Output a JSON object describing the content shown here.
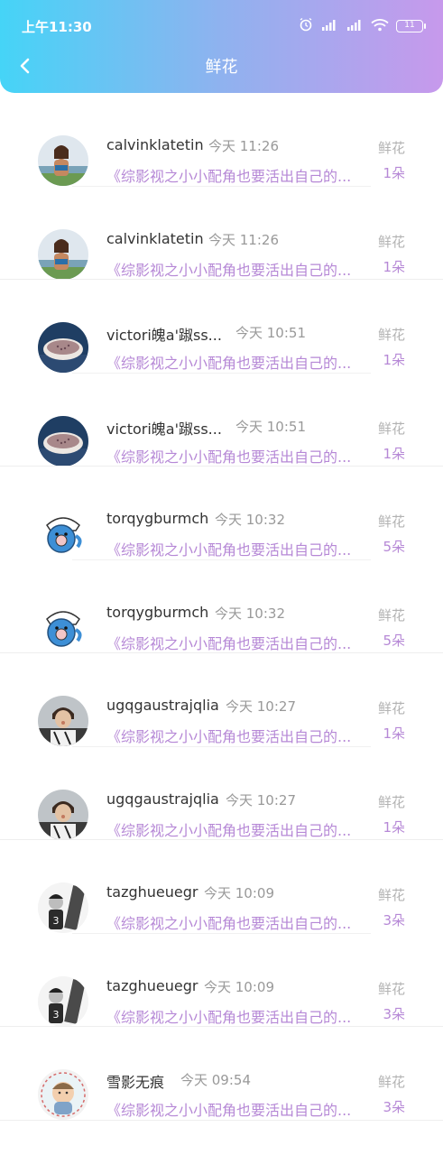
{
  "status": {
    "time": "上午11:30",
    "battery": "11"
  },
  "header": {
    "title": "鲜花"
  },
  "items": [
    {
      "username": "calvinklatetin",
      "time": "今天 11:26",
      "subject": "《综影视之小小配角也要活出自己的...",
      "gift": "鲜花",
      "count": "1朵",
      "avatar": "beach-woman"
    },
    {
      "username": "calvinklatetin",
      "time": "今天 11:26",
      "subject": "《综影视之小小配角也要活出自己的...",
      "gift": "鲜花",
      "count": "1朵",
      "avatar": "beach-woman"
    },
    {
      "username": "victori魄a'踧ss...",
      "time": "今天 10:51",
      "subject": "《综影视之小小配角也要活出自己的...",
      "gift": "鲜花",
      "count": "1朵",
      "avatar": "coffee-cup"
    },
    {
      "username": "victori魄a'踧ss...",
      "time": "今天 10:51",
      "subject": "《综影视之小小配角也要活出自己的...",
      "gift": "鲜花",
      "count": "1朵",
      "avatar": "coffee-cup"
    },
    {
      "username": "torqygburmch",
      "time": "今天 10:32",
      "subject": "《综影视之小小配角也要活出自己的...",
      "gift": "鲜花",
      "count": "5朵",
      "avatar": "cartoon-blue"
    },
    {
      "username": "torqygburmch",
      "time": "今天 10:32",
      "subject": "《综影视之小小配角也要活出自己的...",
      "gift": "鲜花",
      "count": "5朵",
      "avatar": "cartoon-blue"
    },
    {
      "username": "ugqgaustrajqlia",
      "time": "今天 10:27",
      "subject": "《综影视之小小配角也要活出自己的...",
      "gift": "鲜花",
      "count": "1朵",
      "avatar": "boy-photo"
    },
    {
      "username": "ugqgaustrajqlia",
      "time": "今天 10:27",
      "subject": "《综影视之小小配角也要活出自己的...",
      "gift": "鲜花",
      "count": "1朵",
      "avatar": "boy-photo"
    },
    {
      "username": "tazghueuegr",
      "time": "今天 10:09",
      "subject": "《综影视之小小配角也要活出自己的...",
      "gift": "鲜花",
      "count": "3朵",
      "avatar": "bw-boy"
    },
    {
      "username": "tazghueuegr",
      "time": "今天 10:09",
      "subject": "《综影视之小小配角也要活出自己的...",
      "gift": "鲜花",
      "count": "3朵",
      "avatar": "bw-boy"
    },
    {
      "username": "雪影无痕",
      "time": "今天 09:54",
      "subject": "《综影视之小小配角也要活出自己的...",
      "gift": "鲜花",
      "count": "3朵",
      "avatar": "baby-photo"
    }
  ]
}
